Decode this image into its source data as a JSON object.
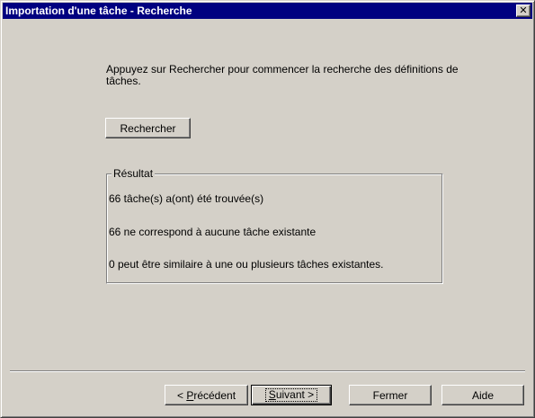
{
  "window": {
    "title": "Importation d'une tâche - Recherche",
    "close_glyph": "✕"
  },
  "instruction": "Appuyez sur Rechercher pour commencer la recherche des définitions de tâches.",
  "search_button": "Rechercher",
  "results": {
    "legend": "Résultat",
    "lines": [
      "66 tâche(s) a(ont) été trouvée(s)",
      "66 ne correspond à aucune tâche existante",
      "0 peut être similaire à une ou plusieurs tâches existantes."
    ]
  },
  "footer": {
    "previous": {
      "prefix": "< ",
      "mnemonic": "P",
      "rest": "récédent"
    },
    "next": {
      "mnemonic": "S",
      "rest": "uivant >"
    },
    "close": "Fermer",
    "help": "Aide"
  }
}
